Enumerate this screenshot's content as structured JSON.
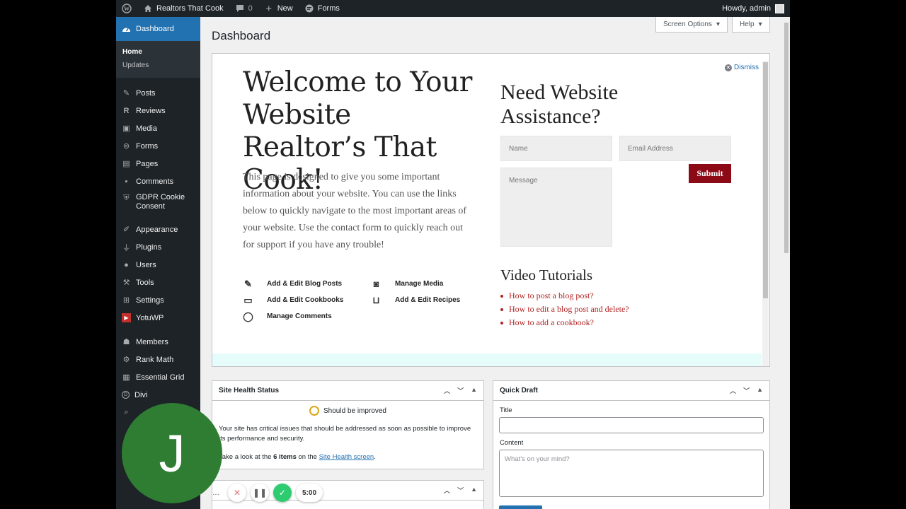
{
  "adminbar": {
    "site_name": "Realtors That Cook",
    "comments_count": "0",
    "new_label": "New",
    "forms_label": "Forms",
    "howdy": "Howdy, admin"
  },
  "sidebar": {
    "dashboard": "Dashboard",
    "submenu": [
      "Home",
      "Updates"
    ],
    "items": [
      "Posts",
      "Reviews",
      "Media",
      "Forms",
      "Pages",
      "Comments",
      "GDPR Cookie Consent",
      "Appearance",
      "Plugins",
      "Users",
      "Tools",
      "Settings",
      "YotuWP",
      "Members",
      "Rank Math",
      "Essential Grid",
      "Divi"
    ]
  },
  "page": {
    "title": "Dashboard",
    "screen_options": "Screen Options",
    "help": "Help"
  },
  "welcome": {
    "dismiss": "Dismiss",
    "title": "Welcome to Your Website Realtor’s That Cook!",
    "text": "This page is designed to give you some important information about your website. You can use the links below to quickly navigate to the most important areas of your website. Use the contact form to quickly reach out for support if you have any trouble!",
    "links": [
      "Add & Edit Blog Posts",
      "Manage Media",
      "Add & Edit Cookbooks",
      "Add & Edit Recipes",
      "Manage Comments"
    ],
    "assist_title": "Need Website Assistance?",
    "name_placeholder": "Name",
    "email_placeholder": "Email Address",
    "message_placeholder": "Message",
    "submit": "Submit",
    "video_title": "Video Tutorials",
    "videos": [
      "How to post a blog post?",
      "How to edit a blog post and delete?",
      "How to add a cookbook?"
    ]
  },
  "site_health": {
    "title": "Site Health Status",
    "status": "Should be improved",
    "text": "Your site has critical issues that should be addressed as soon as possible to improve its performance and security.",
    "items_pre": "Take a look at the",
    "items_count": "6 items",
    "items_mid": "on the",
    "items_link": "Site Health screen",
    "items_end": "."
  },
  "quick_draft": {
    "title": "Quick Draft",
    "title_label": "Title",
    "content_label": "Content",
    "content_placeholder": "What’s on your mind?"
  },
  "recorder": {
    "avatar_letter": "J",
    "time": "5:00"
  },
  "colors": {
    "admin_dark": "#1d2327",
    "accent": "#2271b1",
    "submit": "#8b0a16",
    "video_link": "#b22222",
    "avatar": "#2e7d32"
  }
}
